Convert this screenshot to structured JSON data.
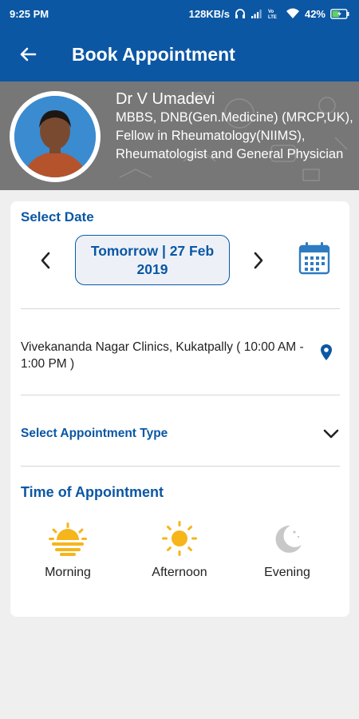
{
  "status_bar": {
    "time": "9:25 PM",
    "speed": "128KB/s",
    "battery": "42%"
  },
  "app_bar": {
    "title": "Book Appointment",
    "back_icon": "arrow-left-icon"
  },
  "doctor": {
    "name": "Dr V Umadevi",
    "qualifications": "MBBS, DNB(Gen.Medicine) (MRCP,UK), Fellow in Rheumatology(NIIMS), Rheumatologist and General Physician"
  },
  "select_date": {
    "title": "Select Date",
    "date_label": "Tomorrow | 27 Feb 2019",
    "prev_icon": "chevron-left-icon",
    "next_icon": "chevron-right-icon",
    "calendar_icon": "calendar-icon"
  },
  "clinic": {
    "label": "Vivekananda Nagar Clinics, Kukatpally ( 10:00 AM - 1:00 PM )",
    "icon": "location-pin-icon"
  },
  "appointment_type": {
    "label": "Select Appointment Type",
    "icon": "chevron-down-icon"
  },
  "time_of_appointment": {
    "title": "Time of Appointment",
    "options": [
      {
        "label": "Morning",
        "icon": "sunrise-icon"
      },
      {
        "label": "Afternoon",
        "icon": "sun-icon"
      },
      {
        "label": "Evening",
        "icon": "moon-icon"
      }
    ]
  },
  "colors": {
    "primary": "#0b57a4",
    "sun": "#f5b51b",
    "muted_icon": "#c8c8c8"
  }
}
